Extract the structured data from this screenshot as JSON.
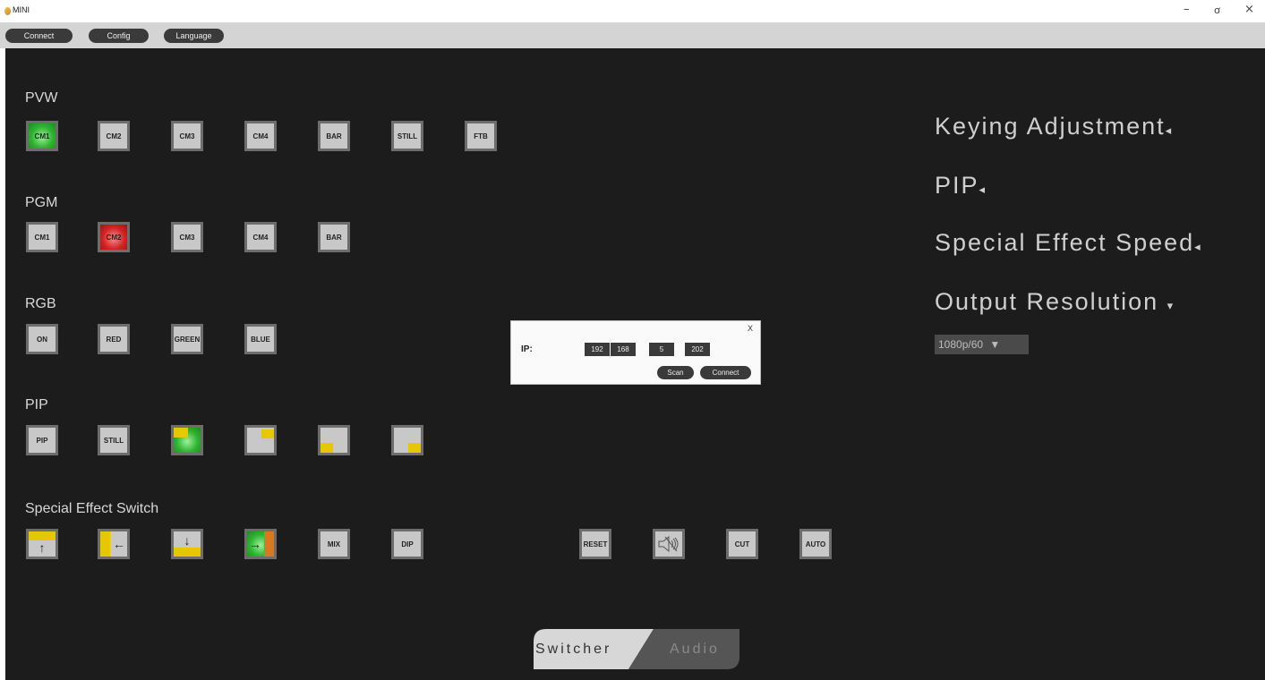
{
  "app": {
    "title": "MINI"
  },
  "window_controls": {
    "minimize": "–",
    "maximize": "ơ",
    "close": "×"
  },
  "menu": {
    "connect": "Connect",
    "config": "Config",
    "language": "Language"
  },
  "pvw": {
    "label": "PVW",
    "buttons": [
      "CM1",
      "CM2",
      "CM3",
      "CM4",
      "BAR",
      "STILL",
      "FTB"
    ],
    "active": "CM1"
  },
  "pgm": {
    "label": "PGM",
    "buttons": [
      "CM1",
      "CM2",
      "CM3",
      "CM4",
      "BAR"
    ],
    "active": "CM2"
  },
  "rgb": {
    "label": "RGB",
    "buttons": [
      "ON",
      "RED",
      "GREEN",
      "BLUE"
    ]
  },
  "pip": {
    "label": "PIP",
    "buttons": [
      "PIP",
      "STILL"
    ]
  },
  "effects": {
    "label": "Special Effect Switch",
    "buttons": [
      "MIX",
      "DIP"
    ],
    "controls": [
      "RESET",
      "CUT",
      "AUTO"
    ],
    "arrows": {
      "up": "↑",
      "left": "←",
      "down": "↓",
      "right": "→"
    }
  },
  "right_panel": {
    "keying": "Keying Adjustment",
    "pip": "PIP",
    "effect_speed": "Special Effect Speed",
    "output_resolution": "Output Resolution",
    "resolution_value": "1080p/60",
    "caret_left": "◂",
    "caret_down": "▾"
  },
  "dialog": {
    "close": "X",
    "ip_label": "IP:",
    "ip": [
      "192",
      "168",
      "5",
      "202"
    ],
    "scan": "Scan",
    "connect": "Connect"
  },
  "tabs": {
    "switcher": "Switcher",
    "audio": "Audio"
  },
  "colors": {
    "active_green": "#2fb42f",
    "active_red": "#d42424",
    "pip_yellow": "#e5c800"
  }
}
